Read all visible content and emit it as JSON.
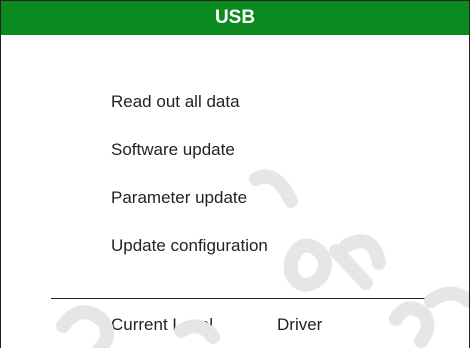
{
  "header": {
    "title": "USB"
  },
  "menu": {
    "items": [
      {
        "label": "Read out all data"
      },
      {
        "label": "Software update"
      },
      {
        "label": "Parameter update"
      },
      {
        "label": "Update configuration"
      }
    ]
  },
  "status": {
    "level_label": "Current Level",
    "role_label": "Driver"
  },
  "colors": {
    "title_bar": "#0a8a1f",
    "title_text": "#ffffff",
    "text": "#222222",
    "watermark": "#e6e6e6"
  }
}
